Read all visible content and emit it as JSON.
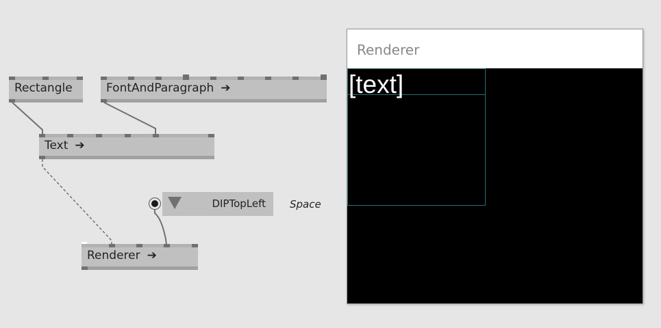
{
  "nodes": {
    "rectangle": {
      "label": "Rectangle"
    },
    "font_and_paragraph": {
      "label": "FontAndParagraph",
      "arrow": "➔"
    },
    "text": {
      "label": "Text",
      "arrow": "➔"
    },
    "renderer": {
      "label": "Renderer",
      "arrow": "➔"
    }
  },
  "iobox": {
    "value": "DIPTopLeft",
    "pin_label": "Space"
  },
  "renderer_window": {
    "title": "Renderer",
    "rendered_text": "[text]"
  },
  "colors": {
    "canvas": "#e6e6e6",
    "node": "#c0c0c0",
    "wire": "#707070",
    "outline": "#2d6e70"
  }
}
